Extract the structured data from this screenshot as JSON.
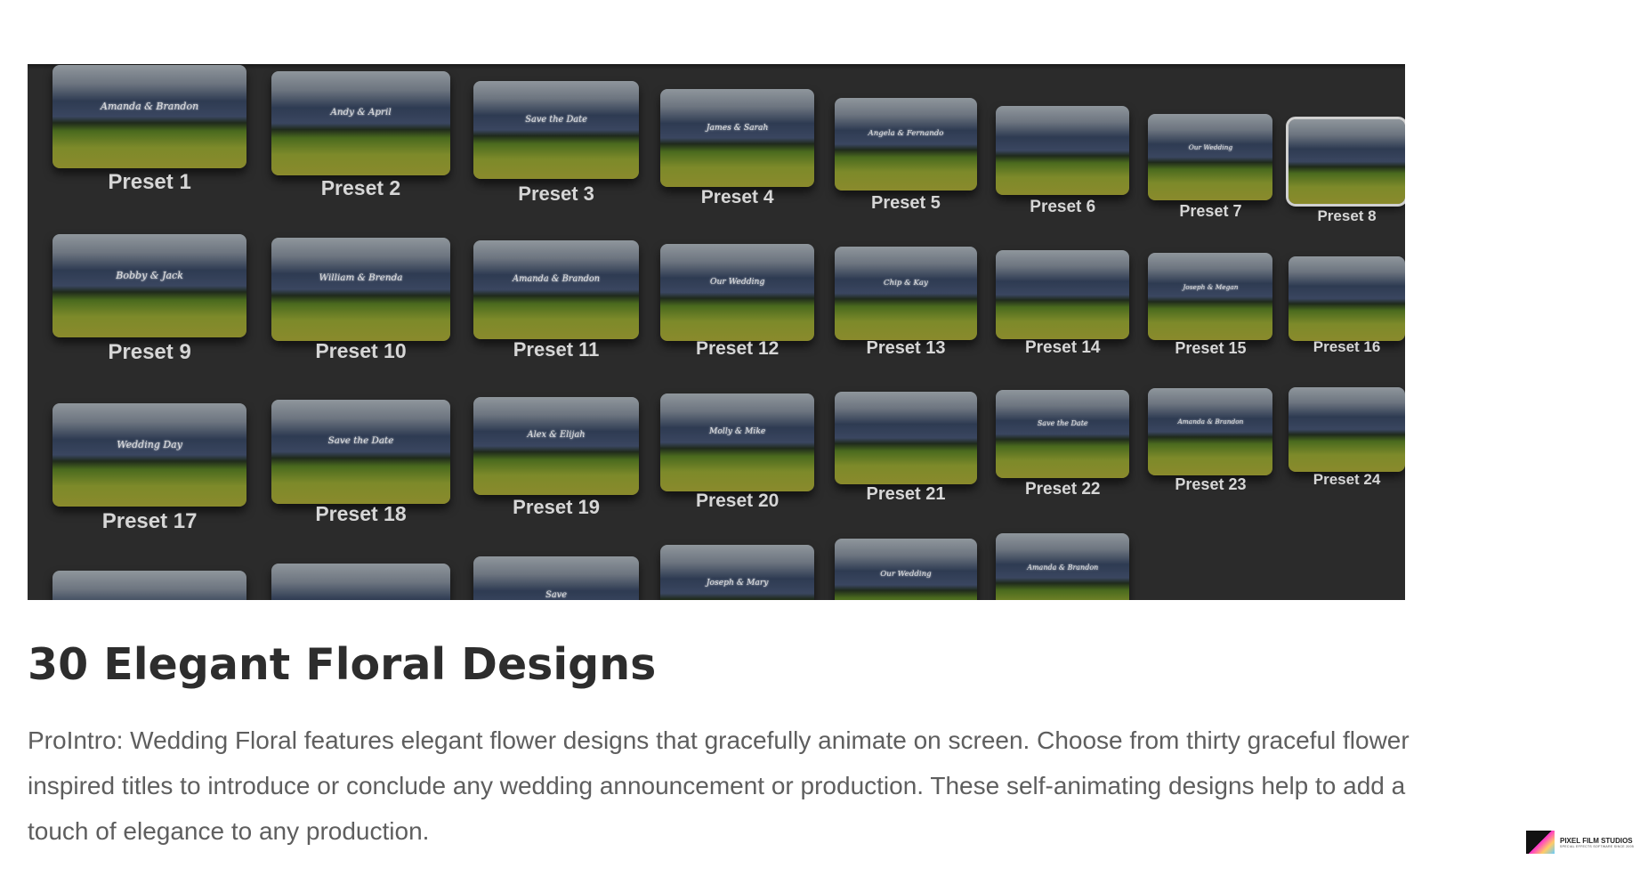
{
  "gallery": {
    "presets": [
      {
        "label": "Preset 1",
        "title": "Amanda & Brandon"
      },
      {
        "label": "Preset 2",
        "title": "Andy & April"
      },
      {
        "label": "Preset 3",
        "title": "Save the Date"
      },
      {
        "label": "Preset 4",
        "title": "James & Sarah"
      },
      {
        "label": "Preset 5",
        "title": "Angela & Fernando"
      },
      {
        "label": "Preset 6",
        "title": ""
      },
      {
        "label": "Preset 7",
        "title": "Our Wedding"
      },
      {
        "label": "Preset 8",
        "title": ""
      },
      {
        "label": "Preset 9",
        "title": "Bobby & Jack"
      },
      {
        "label": "Preset 10",
        "title": "William & Brenda"
      },
      {
        "label": "Preset 11",
        "title": "Amanda & Brandon"
      },
      {
        "label": "Preset 12",
        "title": "Our Wedding"
      },
      {
        "label": "Preset 13",
        "title": "Chip & Kay"
      },
      {
        "label": "Preset 14",
        "title": ""
      },
      {
        "label": "Preset 15",
        "title": "Joseph & Megan"
      },
      {
        "label": "Preset 16",
        "title": ""
      },
      {
        "label": "Preset 17",
        "title": "Wedding Day"
      },
      {
        "label": "Preset 18",
        "title": "Save the Date"
      },
      {
        "label": "Preset 19",
        "title": "Alex & Elijah"
      },
      {
        "label": "Preset 20",
        "title": "Molly & Mike"
      },
      {
        "label": "Preset 21",
        "title": ""
      },
      {
        "label": "Preset 22",
        "title": "Save the Date"
      },
      {
        "label": "Preset 23",
        "title": "Amanda & Brandon"
      },
      {
        "label": "Preset 24",
        "title": ""
      },
      {
        "label": "",
        "title": ""
      },
      {
        "label": "",
        "title": ""
      },
      {
        "label": "",
        "title": "Save"
      },
      {
        "label": "",
        "title": "Joseph & Mary"
      },
      {
        "label": "",
        "title": "Our Wedding"
      },
      {
        "label": "",
        "title": "Amanda & Brandon"
      }
    ],
    "selected_index": 7
  },
  "heading": "30 Elegant Floral Designs",
  "description": "ProIntro: Wedding Floral features elegant flower designs that gracefully animate on screen. Choose from thirty graceful flower inspired titles to introduce or conclude any wedding announcement or production. These self-animating designs help to add a touch of elegance to any production.",
  "logo": {
    "name": "PIXEL FILM STUDIOS",
    "tagline": "SPECIAL EFFECTS SOFTWARE SINCE 2005"
  }
}
